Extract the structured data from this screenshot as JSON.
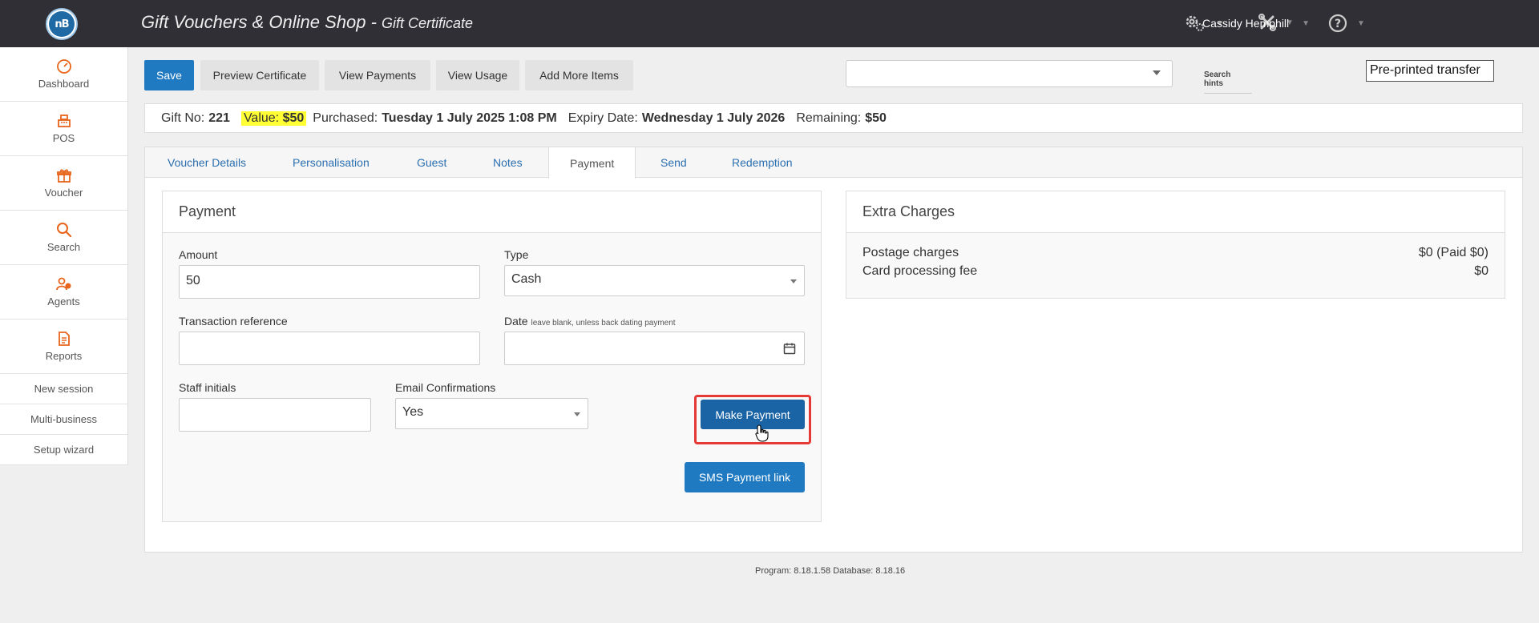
{
  "header": {
    "app_title": "Gift Vouchers & Online Shop",
    "separator": " - ",
    "subtitle": "Gift Certificate",
    "user_name": "Cassidy Hemphill"
  },
  "sidebar": {
    "items": [
      {
        "label": "Dashboard",
        "icon": "dashboard-icon"
      },
      {
        "label": "POS",
        "icon": "register-icon"
      },
      {
        "label": "Voucher",
        "icon": "gift-icon"
      },
      {
        "label": "Search",
        "icon": "search-icon"
      },
      {
        "label": "Agents",
        "icon": "agents-icon"
      },
      {
        "label": "Reports",
        "icon": "report-icon"
      }
    ],
    "links": [
      "New session",
      "Multi-business",
      "Setup wizard"
    ]
  },
  "toolbar": {
    "save": "Save",
    "preview": "Preview Certificate",
    "view_payments": "View Payments",
    "view_usage": "View Usage",
    "add_more": "Add More Items",
    "search_hints": "Search hints",
    "preprinted_value": "Pre-printed transfer"
  },
  "info": {
    "gift_no_label": "Gift No:",
    "gift_no": "221",
    "value_label": "Value:",
    "value": "$50",
    "purchased_label": "Purchased:",
    "purchased": "Tuesday 1 July 2025 1:08 PM",
    "expiry_label": "Expiry Date:",
    "expiry": "Wednesday 1 July 2026",
    "remaining_label": "Remaining:",
    "remaining": "$50"
  },
  "tabs": [
    "Voucher Details",
    "Personalisation",
    "Guest",
    "Notes",
    "Payment",
    "Send",
    "Redemption"
  ],
  "payment": {
    "title": "Payment",
    "amount_label": "Amount",
    "amount_value": "50",
    "type_label": "Type",
    "type_value": "Cash",
    "txn_label": "Transaction reference",
    "txn_value": "",
    "date_label": "Date",
    "date_hint": "leave blank, unless back dating payment",
    "date_value": "",
    "staff_label": "Staff initials",
    "staff_value": "",
    "email_label": "Email Confirmations",
    "email_value": "Yes",
    "make_payment": "Make Payment",
    "sms_payment": "SMS Payment link"
  },
  "extra_charges": {
    "title": "Extra Charges",
    "rows": [
      {
        "label": "Postage charges",
        "value": "$0 (Paid $0)"
      },
      {
        "label": "Card processing fee",
        "value": "$0"
      }
    ]
  },
  "footer": {
    "version": "Program: 8.18.1.58 Database: 8.18.16"
  },
  "colors": {
    "topbar": "#2f2f35",
    "primary": "#1f7ac2",
    "accent_orange": "#e8641b",
    "highlight_red": "#e53935"
  }
}
